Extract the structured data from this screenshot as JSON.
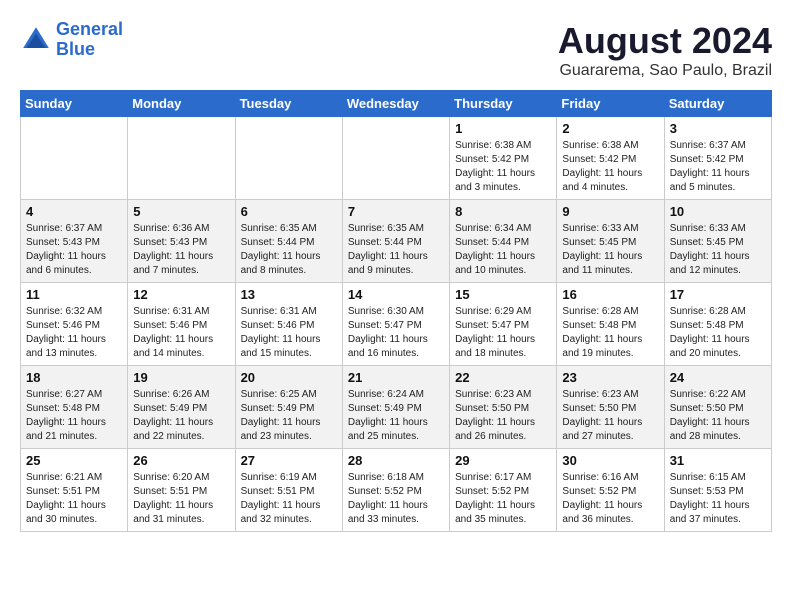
{
  "header": {
    "logo_line1": "General",
    "logo_line2": "Blue",
    "main_title": "August 2024",
    "subtitle": "Guararema, Sao Paulo, Brazil"
  },
  "calendar": {
    "headers": [
      "Sunday",
      "Monday",
      "Tuesday",
      "Wednesday",
      "Thursday",
      "Friday",
      "Saturday"
    ],
    "weeks": [
      [
        {
          "day": "",
          "info": ""
        },
        {
          "day": "",
          "info": ""
        },
        {
          "day": "",
          "info": ""
        },
        {
          "day": "",
          "info": ""
        },
        {
          "day": "1",
          "info": "Sunrise: 6:38 AM\nSunset: 5:42 PM\nDaylight: 11 hours\nand 3 minutes."
        },
        {
          "day": "2",
          "info": "Sunrise: 6:38 AM\nSunset: 5:42 PM\nDaylight: 11 hours\nand 4 minutes."
        },
        {
          "day": "3",
          "info": "Sunrise: 6:37 AM\nSunset: 5:42 PM\nDaylight: 11 hours\nand 5 minutes."
        }
      ],
      [
        {
          "day": "4",
          "info": "Sunrise: 6:37 AM\nSunset: 5:43 PM\nDaylight: 11 hours\nand 6 minutes."
        },
        {
          "day": "5",
          "info": "Sunrise: 6:36 AM\nSunset: 5:43 PM\nDaylight: 11 hours\nand 7 minutes."
        },
        {
          "day": "6",
          "info": "Sunrise: 6:35 AM\nSunset: 5:44 PM\nDaylight: 11 hours\nand 8 minutes."
        },
        {
          "day": "7",
          "info": "Sunrise: 6:35 AM\nSunset: 5:44 PM\nDaylight: 11 hours\nand 9 minutes."
        },
        {
          "day": "8",
          "info": "Sunrise: 6:34 AM\nSunset: 5:44 PM\nDaylight: 11 hours\nand 10 minutes."
        },
        {
          "day": "9",
          "info": "Sunrise: 6:33 AM\nSunset: 5:45 PM\nDaylight: 11 hours\nand 11 minutes."
        },
        {
          "day": "10",
          "info": "Sunrise: 6:33 AM\nSunset: 5:45 PM\nDaylight: 11 hours\nand 12 minutes."
        }
      ],
      [
        {
          "day": "11",
          "info": "Sunrise: 6:32 AM\nSunset: 5:46 PM\nDaylight: 11 hours\nand 13 minutes."
        },
        {
          "day": "12",
          "info": "Sunrise: 6:31 AM\nSunset: 5:46 PM\nDaylight: 11 hours\nand 14 minutes."
        },
        {
          "day": "13",
          "info": "Sunrise: 6:31 AM\nSunset: 5:46 PM\nDaylight: 11 hours\nand 15 minutes."
        },
        {
          "day": "14",
          "info": "Sunrise: 6:30 AM\nSunset: 5:47 PM\nDaylight: 11 hours\nand 16 minutes."
        },
        {
          "day": "15",
          "info": "Sunrise: 6:29 AM\nSunset: 5:47 PM\nDaylight: 11 hours\nand 18 minutes."
        },
        {
          "day": "16",
          "info": "Sunrise: 6:28 AM\nSunset: 5:48 PM\nDaylight: 11 hours\nand 19 minutes."
        },
        {
          "day": "17",
          "info": "Sunrise: 6:28 AM\nSunset: 5:48 PM\nDaylight: 11 hours\nand 20 minutes."
        }
      ],
      [
        {
          "day": "18",
          "info": "Sunrise: 6:27 AM\nSunset: 5:48 PM\nDaylight: 11 hours\nand 21 minutes."
        },
        {
          "day": "19",
          "info": "Sunrise: 6:26 AM\nSunset: 5:49 PM\nDaylight: 11 hours\nand 22 minutes."
        },
        {
          "day": "20",
          "info": "Sunrise: 6:25 AM\nSunset: 5:49 PM\nDaylight: 11 hours\nand 23 minutes."
        },
        {
          "day": "21",
          "info": "Sunrise: 6:24 AM\nSunset: 5:49 PM\nDaylight: 11 hours\nand 25 minutes."
        },
        {
          "day": "22",
          "info": "Sunrise: 6:23 AM\nSunset: 5:50 PM\nDaylight: 11 hours\nand 26 minutes."
        },
        {
          "day": "23",
          "info": "Sunrise: 6:23 AM\nSunset: 5:50 PM\nDaylight: 11 hours\nand 27 minutes."
        },
        {
          "day": "24",
          "info": "Sunrise: 6:22 AM\nSunset: 5:50 PM\nDaylight: 11 hours\nand 28 minutes."
        }
      ],
      [
        {
          "day": "25",
          "info": "Sunrise: 6:21 AM\nSunset: 5:51 PM\nDaylight: 11 hours\nand 30 minutes."
        },
        {
          "day": "26",
          "info": "Sunrise: 6:20 AM\nSunset: 5:51 PM\nDaylight: 11 hours\nand 31 minutes."
        },
        {
          "day": "27",
          "info": "Sunrise: 6:19 AM\nSunset: 5:51 PM\nDaylight: 11 hours\nand 32 minutes."
        },
        {
          "day": "28",
          "info": "Sunrise: 6:18 AM\nSunset: 5:52 PM\nDaylight: 11 hours\nand 33 minutes."
        },
        {
          "day": "29",
          "info": "Sunrise: 6:17 AM\nSunset: 5:52 PM\nDaylight: 11 hours\nand 35 minutes."
        },
        {
          "day": "30",
          "info": "Sunrise: 6:16 AM\nSunset: 5:52 PM\nDaylight: 11 hours\nand 36 minutes."
        },
        {
          "day": "31",
          "info": "Sunrise: 6:15 AM\nSunset: 5:53 PM\nDaylight: 11 hours\nand 37 minutes."
        }
      ]
    ]
  }
}
